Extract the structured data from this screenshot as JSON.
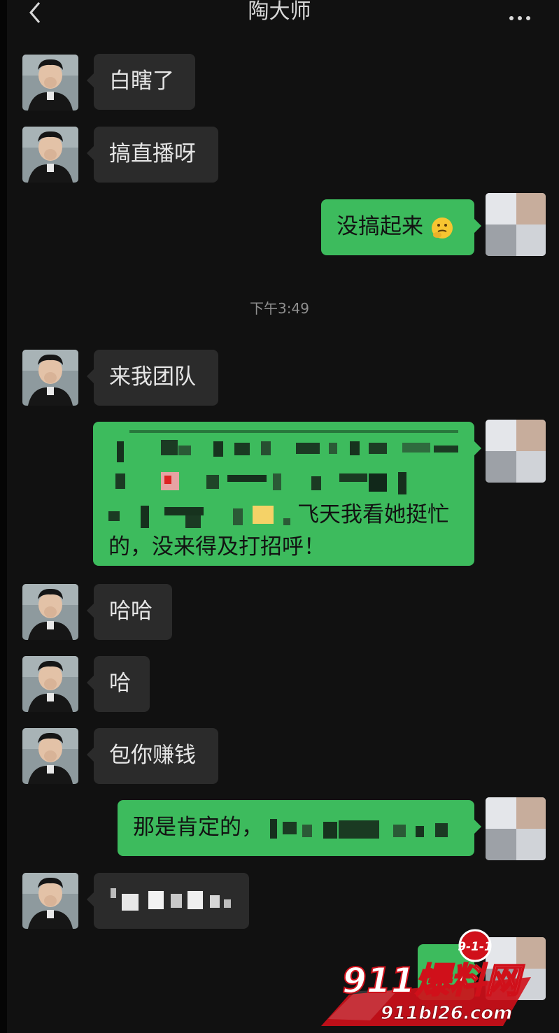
{
  "header": {
    "title": "陶大师",
    "back_icon": "chevron-left-icon",
    "more_icon": "more-dots-icon"
  },
  "messages": [
    {
      "side": "left",
      "text": "白瞎了"
    },
    {
      "side": "left",
      "text": "搞直播呀"
    },
    {
      "side": "right",
      "text": "没搞起来",
      "emoji": "thinking-face-emoji"
    },
    {
      "side": "left",
      "text": "来我团队"
    },
    {
      "side": "right",
      "text_visible_1": "飞天我看她挺忙",
      "text_visible_2": "的，没来得及打招呼！"
    },
    {
      "side": "left",
      "text": "哈哈"
    },
    {
      "side": "left",
      "text": "哈"
    },
    {
      "side": "left",
      "text": "包你赚钱"
    },
    {
      "side": "right",
      "text": "那是肯定的，"
    },
    {
      "side": "left",
      "text": ""
    },
    {
      "side": "right",
      "text": ""
    }
  ],
  "timestamp": "下午3:49",
  "watermark": {
    "badge": "9-1-1",
    "brand": "911爆料网",
    "url": "911bl26.com"
  },
  "colors": {
    "background": "#111111",
    "incoming_bubble": "#2b2b2b",
    "outgoing_bubble": "#3dbb5d",
    "watermark_red": "#d0101a"
  }
}
